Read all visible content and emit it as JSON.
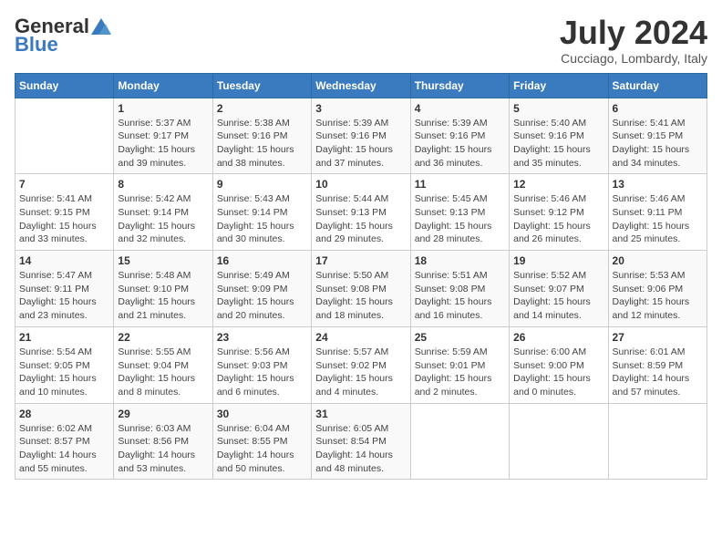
{
  "header": {
    "logo_general": "General",
    "logo_blue": "Blue",
    "month_year": "July 2024",
    "location": "Cucciago, Lombardy, Italy"
  },
  "days_of_week": [
    "Sunday",
    "Monday",
    "Tuesday",
    "Wednesday",
    "Thursday",
    "Friday",
    "Saturday"
  ],
  "weeks": [
    [
      {
        "day": "",
        "content": ""
      },
      {
        "day": "1",
        "content": "Sunrise: 5:37 AM\nSunset: 9:17 PM\nDaylight: 15 hours\nand 39 minutes."
      },
      {
        "day": "2",
        "content": "Sunrise: 5:38 AM\nSunset: 9:16 PM\nDaylight: 15 hours\nand 38 minutes."
      },
      {
        "day": "3",
        "content": "Sunrise: 5:39 AM\nSunset: 9:16 PM\nDaylight: 15 hours\nand 37 minutes."
      },
      {
        "day": "4",
        "content": "Sunrise: 5:39 AM\nSunset: 9:16 PM\nDaylight: 15 hours\nand 36 minutes."
      },
      {
        "day": "5",
        "content": "Sunrise: 5:40 AM\nSunset: 9:16 PM\nDaylight: 15 hours\nand 35 minutes."
      },
      {
        "day": "6",
        "content": "Sunrise: 5:41 AM\nSunset: 9:15 PM\nDaylight: 15 hours\nand 34 minutes."
      }
    ],
    [
      {
        "day": "7",
        "content": "Sunrise: 5:41 AM\nSunset: 9:15 PM\nDaylight: 15 hours\nand 33 minutes."
      },
      {
        "day": "8",
        "content": "Sunrise: 5:42 AM\nSunset: 9:14 PM\nDaylight: 15 hours\nand 32 minutes."
      },
      {
        "day": "9",
        "content": "Sunrise: 5:43 AM\nSunset: 9:14 PM\nDaylight: 15 hours\nand 30 minutes."
      },
      {
        "day": "10",
        "content": "Sunrise: 5:44 AM\nSunset: 9:13 PM\nDaylight: 15 hours\nand 29 minutes."
      },
      {
        "day": "11",
        "content": "Sunrise: 5:45 AM\nSunset: 9:13 PM\nDaylight: 15 hours\nand 28 minutes."
      },
      {
        "day": "12",
        "content": "Sunrise: 5:46 AM\nSunset: 9:12 PM\nDaylight: 15 hours\nand 26 minutes."
      },
      {
        "day": "13",
        "content": "Sunrise: 5:46 AM\nSunset: 9:11 PM\nDaylight: 15 hours\nand 25 minutes."
      }
    ],
    [
      {
        "day": "14",
        "content": "Sunrise: 5:47 AM\nSunset: 9:11 PM\nDaylight: 15 hours\nand 23 minutes."
      },
      {
        "day": "15",
        "content": "Sunrise: 5:48 AM\nSunset: 9:10 PM\nDaylight: 15 hours\nand 21 minutes."
      },
      {
        "day": "16",
        "content": "Sunrise: 5:49 AM\nSunset: 9:09 PM\nDaylight: 15 hours\nand 20 minutes."
      },
      {
        "day": "17",
        "content": "Sunrise: 5:50 AM\nSunset: 9:08 PM\nDaylight: 15 hours\nand 18 minutes."
      },
      {
        "day": "18",
        "content": "Sunrise: 5:51 AM\nSunset: 9:08 PM\nDaylight: 15 hours\nand 16 minutes."
      },
      {
        "day": "19",
        "content": "Sunrise: 5:52 AM\nSunset: 9:07 PM\nDaylight: 15 hours\nand 14 minutes."
      },
      {
        "day": "20",
        "content": "Sunrise: 5:53 AM\nSunset: 9:06 PM\nDaylight: 15 hours\nand 12 minutes."
      }
    ],
    [
      {
        "day": "21",
        "content": "Sunrise: 5:54 AM\nSunset: 9:05 PM\nDaylight: 15 hours\nand 10 minutes."
      },
      {
        "day": "22",
        "content": "Sunrise: 5:55 AM\nSunset: 9:04 PM\nDaylight: 15 hours\nand 8 minutes."
      },
      {
        "day": "23",
        "content": "Sunrise: 5:56 AM\nSunset: 9:03 PM\nDaylight: 15 hours\nand 6 minutes."
      },
      {
        "day": "24",
        "content": "Sunrise: 5:57 AM\nSunset: 9:02 PM\nDaylight: 15 hours\nand 4 minutes."
      },
      {
        "day": "25",
        "content": "Sunrise: 5:59 AM\nSunset: 9:01 PM\nDaylight: 15 hours\nand 2 minutes."
      },
      {
        "day": "26",
        "content": "Sunrise: 6:00 AM\nSunset: 9:00 PM\nDaylight: 15 hours\nand 0 minutes."
      },
      {
        "day": "27",
        "content": "Sunrise: 6:01 AM\nSunset: 8:59 PM\nDaylight: 14 hours\nand 57 minutes."
      }
    ],
    [
      {
        "day": "28",
        "content": "Sunrise: 6:02 AM\nSunset: 8:57 PM\nDaylight: 14 hours\nand 55 minutes."
      },
      {
        "day": "29",
        "content": "Sunrise: 6:03 AM\nSunset: 8:56 PM\nDaylight: 14 hours\nand 53 minutes."
      },
      {
        "day": "30",
        "content": "Sunrise: 6:04 AM\nSunset: 8:55 PM\nDaylight: 14 hours\nand 50 minutes."
      },
      {
        "day": "31",
        "content": "Sunrise: 6:05 AM\nSunset: 8:54 PM\nDaylight: 14 hours\nand 48 minutes."
      },
      {
        "day": "",
        "content": ""
      },
      {
        "day": "",
        "content": ""
      },
      {
        "day": "",
        "content": ""
      }
    ]
  ]
}
